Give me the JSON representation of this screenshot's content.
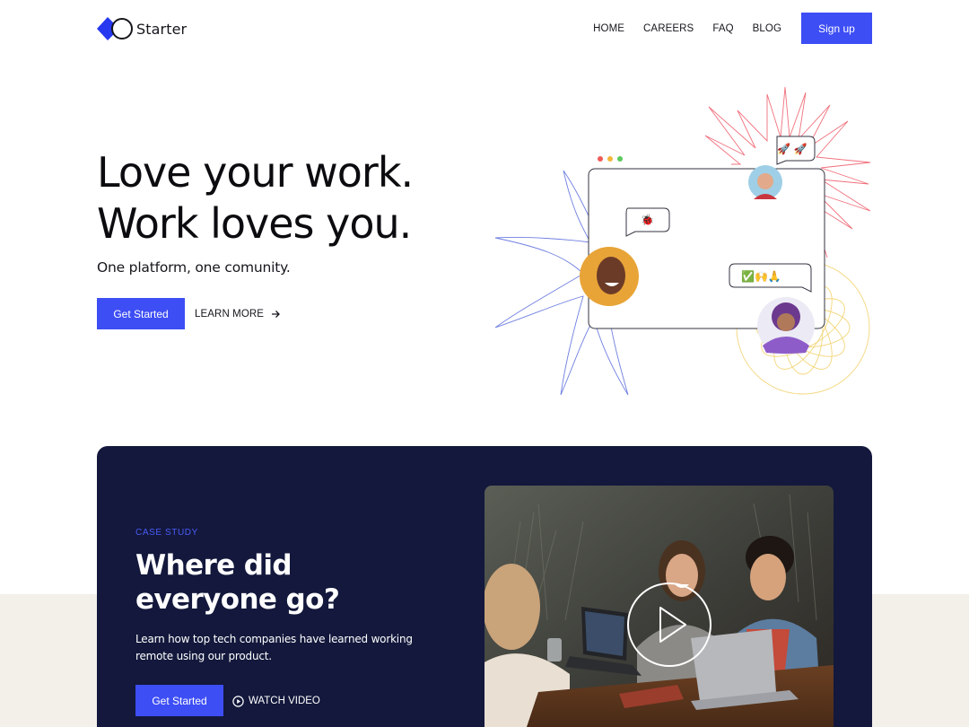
{
  "nav": {
    "brand_name": "Starter",
    "items": [
      {
        "label": "HOME"
      },
      {
        "label": "CAREERS"
      },
      {
        "label": "FAQ"
      },
      {
        "label": "BLOG"
      }
    ],
    "signup_label": "Sign up"
  },
  "hero": {
    "title_line1": "Love your work.",
    "title_line2": "Work loves you.",
    "subtitle": "One platform, one comunity.",
    "cta_label": "Get Started",
    "secondary_label": "LEARN MORE",
    "chat_emojis": {
      "rockets": "🚀 🚀",
      "bug": "🐞",
      "reactions": "✅🙌🙏"
    }
  },
  "case_study": {
    "eyebrow": "CASE STUDY",
    "title_line1": "Where did",
    "title_line2": "everyone go?",
    "description": "Learn how top tech companies have learned working remote using our product.",
    "cta_label": "Get Started",
    "video_label": "WATCH VIDEO"
  },
  "colors": {
    "accent": "#3d4ef5",
    "dark_card": "#13183c",
    "beige": "#f3f0ea",
    "burst_red": "#f0707c",
    "burst_blue": "#6f7fe0",
    "burst_yellow": "#f3d67a"
  }
}
